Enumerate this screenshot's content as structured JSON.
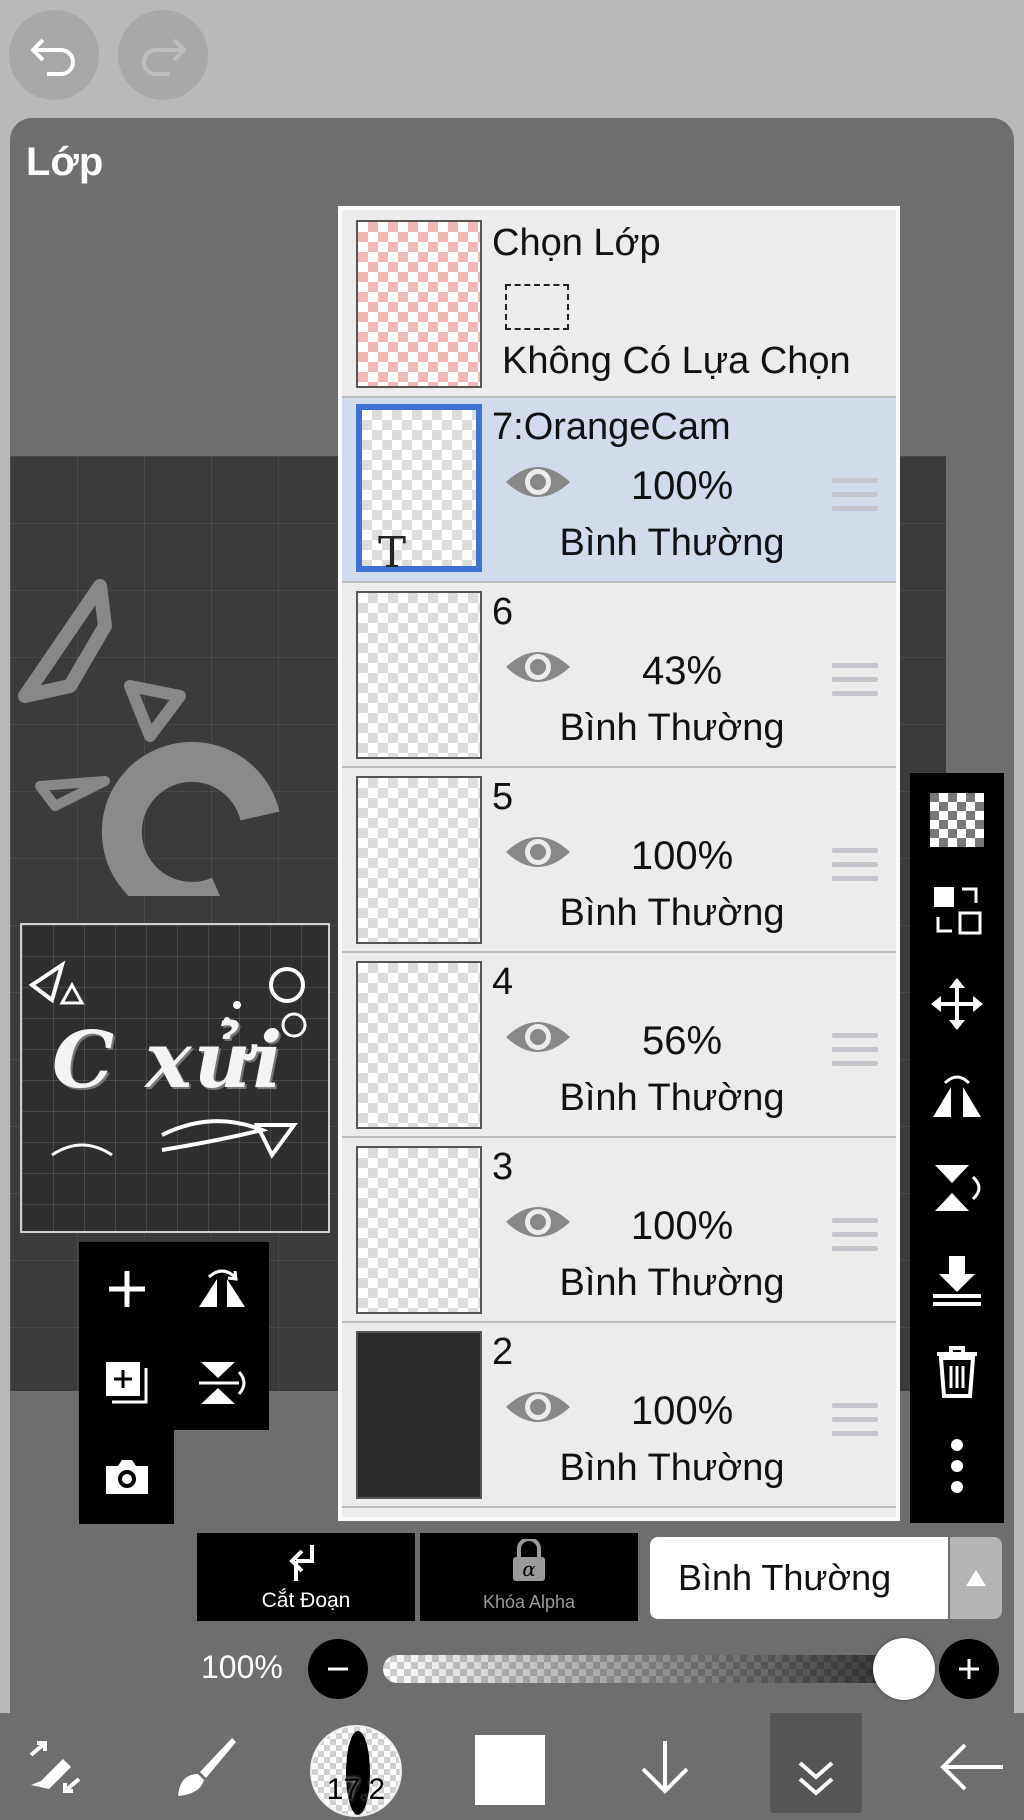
{
  "app": {
    "panel_title": "Lớp"
  },
  "selection_layer": {
    "title": "Chọn Lớp",
    "status": "Không Có Lựa Chọn"
  },
  "layers": [
    {
      "name": "7:OrangeCam",
      "opacity": "100%",
      "blend": "Bình Thường",
      "active": true,
      "kind": "text"
    },
    {
      "name": "6",
      "opacity": "43%",
      "blend": "Bình Thường",
      "active": false
    },
    {
      "name": "5",
      "opacity": "100%",
      "blend": "Bình Thường",
      "active": false
    },
    {
      "name": "4",
      "opacity": "56%",
      "blend": "Bình Thường",
      "active": false
    },
    {
      "name": "3",
      "opacity": "100%",
      "blend": "Bình Thường",
      "active": false
    },
    {
      "name": "2",
      "opacity": "100%",
      "blend": "Bình Thường",
      "active": false
    }
  ],
  "preview": {
    "art_text": "C xửi"
  },
  "controls": {
    "clipping_label": "Cắt Đoạn",
    "alpha_lock_label": "Khóa Alpha",
    "blend_mode": "Bình Thường",
    "opacity_label": "100%",
    "opacity_value": 1.0
  },
  "bottom_bar": {
    "brush_size": "17.2",
    "color": "#ffffff"
  },
  "icons": {
    "undo": "undo-arrow-icon",
    "redo": "redo-arrow-icon",
    "eye": "eye-icon",
    "side": [
      "transparency-checker-icon",
      "transform-layer-icon",
      "move-icon",
      "flip-horizontal-icon",
      "flip-vertical-icon",
      "merge-down-icon",
      "trash-icon",
      "more-vertical-icon"
    ]
  }
}
